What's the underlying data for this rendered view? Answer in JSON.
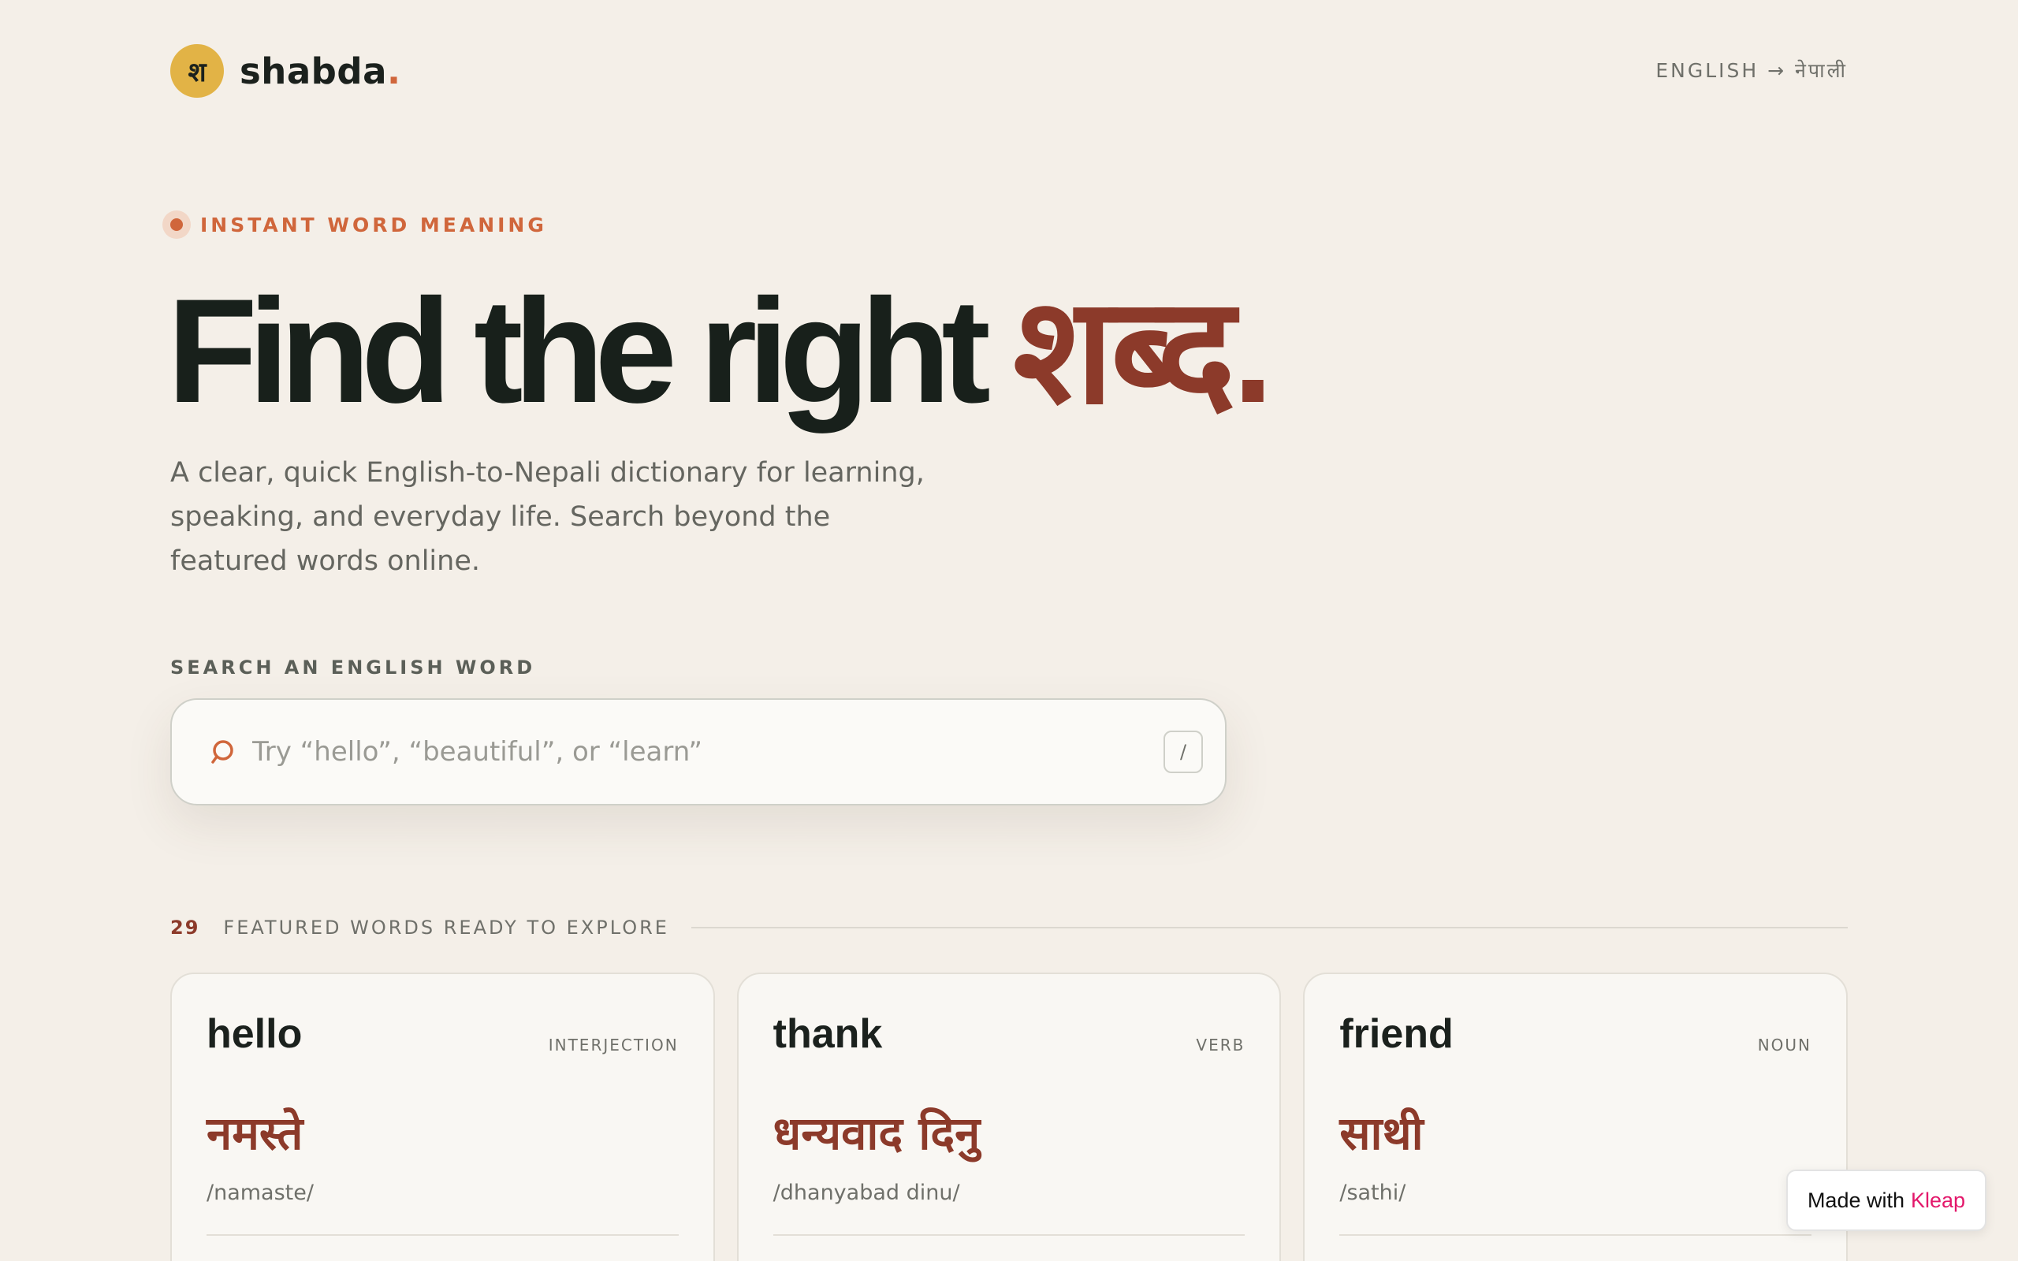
{
  "header": {
    "logo_glyph": "श",
    "brand_name": "shabda",
    "brand_dot": ".",
    "lang_switch": "ENGLISH → नेपाली"
  },
  "hero": {
    "eyebrow": "INSTANT WORD MEANING",
    "title_main": "Find the right ",
    "title_accent": "शब्द.",
    "subtitle": "A clear, quick English-to-Nepali dictionary for learning, speaking, and everyday life. Search beyond the featured words online."
  },
  "search": {
    "label": "SEARCH AN ENGLISH WORD",
    "value": "",
    "placeholder": "Try “hello”, “beautiful”, or “learn”",
    "shortcut": "/"
  },
  "featured": {
    "count": "29",
    "label": "FEATURED WORDS READY TO EXPLORE"
  },
  "cards": [
    {
      "word": "hello",
      "pos": "INTERJECTION",
      "nepali": "नमस्ते",
      "roman": "/namaste/"
    },
    {
      "word": "thank",
      "pos": "VERB",
      "nepali": "धन्यवाद दिनु",
      "roman": "/dhanyabad dinu/"
    },
    {
      "word": "friend",
      "pos": "NOUN",
      "nepali": "साथी",
      "roman": "/sathi/"
    }
  ],
  "badge": {
    "prefix": "Made with",
    "brand": "Kleap"
  },
  "colors": {
    "background": "#f4efe8",
    "accent_orange": "#d0663b",
    "accent_brown": "#8c3a2a",
    "logo_yellow": "#e2b346",
    "kleap_pink": "#e3186b"
  }
}
